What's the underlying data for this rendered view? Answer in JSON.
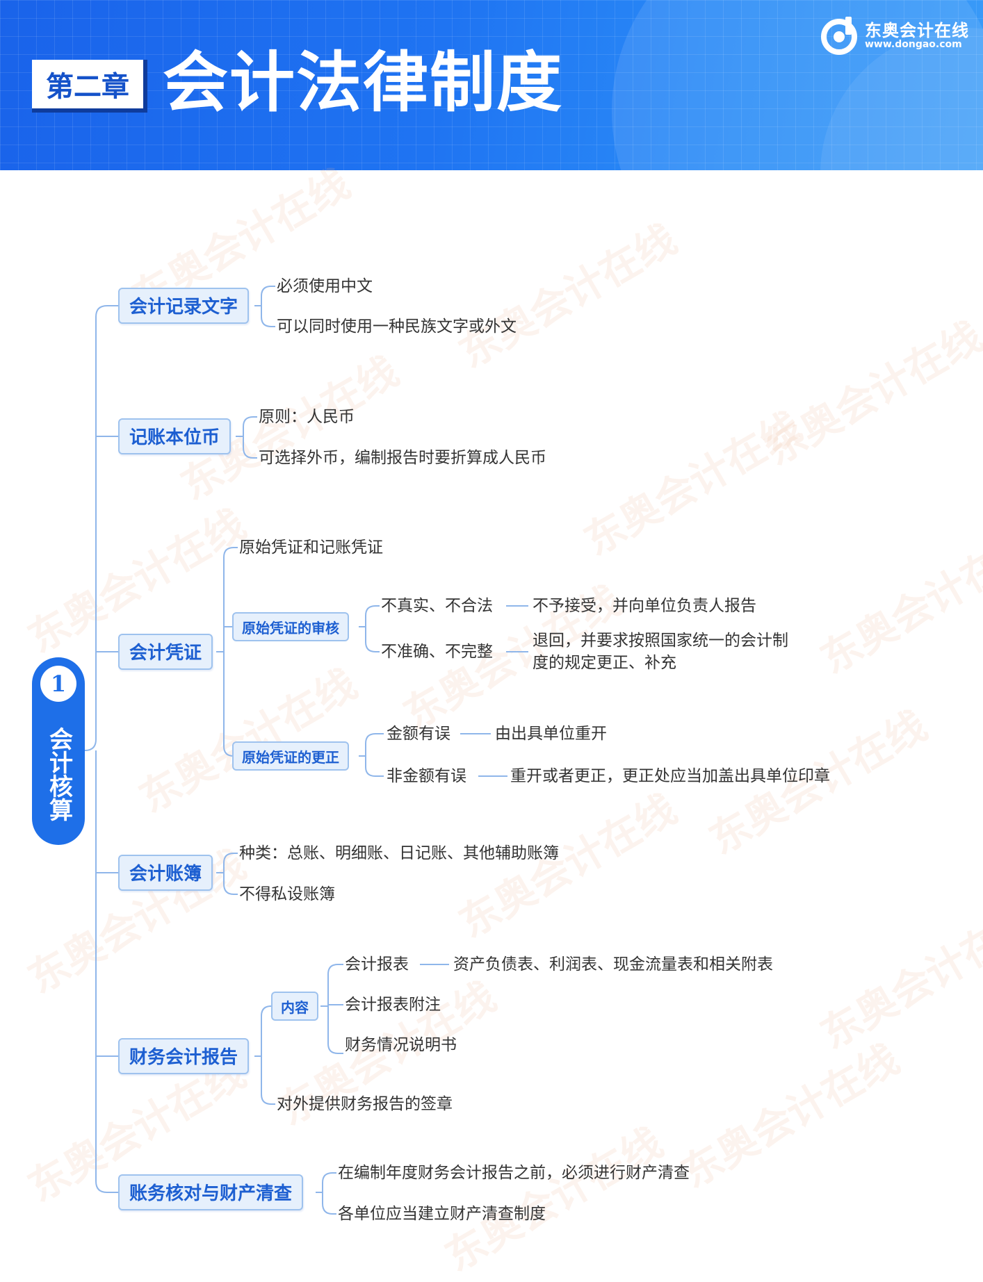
{
  "header": {
    "chapter_badge": "第二章",
    "chapter_title": "会计法律制度",
    "brand_name": "东奥会计在线",
    "brand_url": "www.dongao.com"
  },
  "watermark": {
    "cn": "东奥会计在线",
    "url": "www.dongao.com"
  },
  "colors": {
    "primary_blue": "#1e6fe8",
    "node_fill": "#e6f0fc",
    "node_border": "#9ec2ee",
    "node_text": "#1d5fd1",
    "line": "#8fb6ea"
  },
  "mindmap": {
    "root": {
      "number": "1",
      "label": "会计核算"
    },
    "branches": [
      {
        "label": "会计记录文字",
        "items": [
          "必须使用中文",
          "可以同时使用一种民族文字或外文"
        ]
      },
      {
        "label": "记账本位币",
        "items": [
          "原则：人民币",
          "可选择外币，编制报告时要折算成人民币"
        ]
      },
      {
        "label": "会计凭证",
        "item_top": "原始凭证和记账凭证",
        "sub_audit": {
          "label": "原始凭证的审核",
          "rows": [
            {
              "case": "不真实、不合法",
              "action": "不予接受，并向单位负责人报告"
            },
            {
              "case": "不准确、不完整",
              "action": "退回，并要求按照国家统一的会计制度的规定更正、补充"
            }
          ]
        },
        "sub_correct": {
          "label": "原始凭证的更正",
          "rows": [
            {
              "case": "金额有误",
              "action": "由出具单位重开"
            },
            {
              "case": "非金额有误",
              "action": "重开或者更正，更正处应当加盖出具单位印章"
            }
          ]
        }
      },
      {
        "label": "会计账簿",
        "items": [
          "种类：总账、明细账、日记账、其他辅助账簿",
          "不得私设账簿"
        ]
      },
      {
        "label": "财务会计报告",
        "sub_content": {
          "label": "内容",
          "item_1": "会计报表",
          "item_1_detail": "资产负债表、利润表、现金流量表和相关附表",
          "item_2": "会计报表附注",
          "item_3": "财务情况说明书"
        },
        "item_sign": "对外提供财务报告的签章"
      },
      {
        "label": "账务核对与财产清查",
        "items": [
          "在编制年度财务会计报告之前，必须进行财产清查",
          "各单位应当建立财产清查制度"
        ]
      }
    ]
  }
}
